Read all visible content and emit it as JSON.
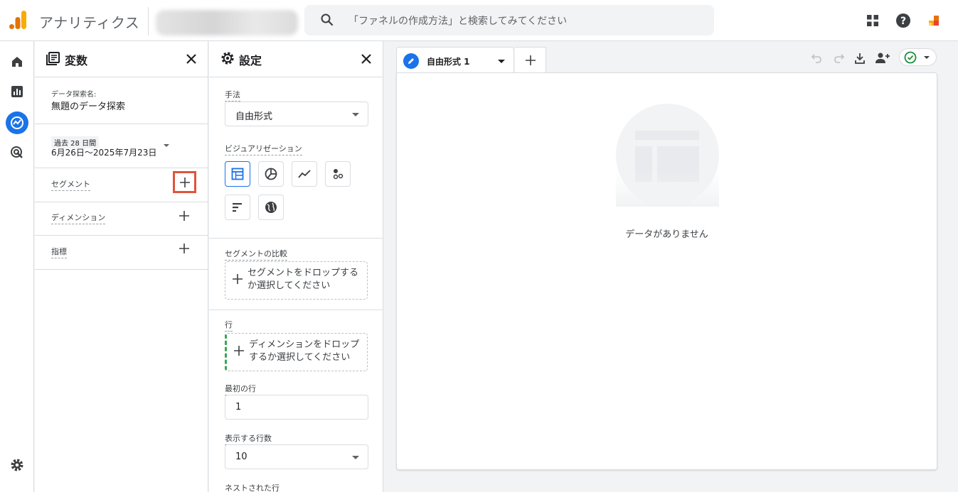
{
  "header": {
    "app_title": "アナリティクス",
    "search_placeholder": "「ファネルの作成方法」と検索してみてください"
  },
  "variables_panel": {
    "title": "変数",
    "exploration_name_label": "データ探索名:",
    "exploration_name": "無題のデータ探索",
    "date_range_badge": "過去 28 日間",
    "date_range": "6月26日〜2025年7月23日",
    "segments_label": "セグメント",
    "dimensions_label": "ディメンション",
    "metrics_label": "指標"
  },
  "settings_panel": {
    "title": "設定",
    "technique_label": "手法",
    "technique_value": "自由形式",
    "visualization_label": "ビジュアリゼーション",
    "segment_comparison_label": "セグメントの比較",
    "segment_drop_text": "セグメントをドロップするか選択してください",
    "rows_label": "行",
    "dimension_drop_text": "ディメンションをドロップするか選択してください",
    "first_row_label": "最初の行",
    "first_row_value": "1",
    "rows_to_show_label": "表示する行数",
    "rows_to_show_value": "10",
    "nested_rows_label": "ネストされた行"
  },
  "canvas": {
    "tab_label": "自由形式 1",
    "empty_message": "データがありません"
  },
  "colors": {
    "accent": "#1a73e8",
    "highlight": "#e0543d",
    "success": "#1e8e3e"
  }
}
